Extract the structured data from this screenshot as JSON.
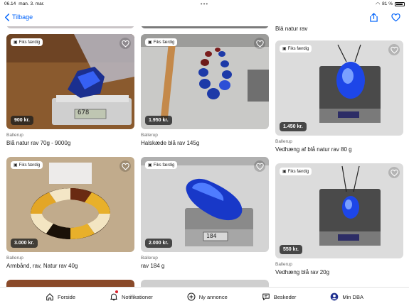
{
  "status_bar": {
    "time": "06.14",
    "date": "man. 3. mar.",
    "battery": "81 %"
  },
  "nav": {
    "back_label": "Tilbage"
  },
  "badge_label": "Fiks færdig",
  "partial_top_title": "Blå natur rav",
  "listings": [
    {
      "price": "900 kr.",
      "location": "Ballerup",
      "title": "Blå natur rav 70g - 9000g"
    },
    {
      "price": "1.950 kr.",
      "location": "Ballerup",
      "title": "Halskæde blå rav 145g"
    },
    {
      "price": "1.450 kr.",
      "location": "Ballerup",
      "title": "Vedhæng af blå natur rav 80 g"
    },
    {
      "price": "3.000 kr.",
      "location": "Ballerup",
      "title": "Armbånd, rav, Natur rav 40g"
    },
    {
      "price": "2.000 kr.",
      "location": "Ballerup",
      "title": "rav 184 g"
    },
    {
      "price": "550 kr.",
      "location": "Ballerup",
      "title": "Vedhæng blå rav 20g"
    }
  ],
  "scale_readouts": {
    "card1": "678",
    "card5": "184"
  },
  "tabs": [
    {
      "label": "Forside",
      "icon": "home-icon"
    },
    {
      "label": "Notifikationer",
      "icon": "bell-icon"
    },
    {
      "label": "Ny annonce",
      "icon": "plus-circle-icon"
    },
    {
      "label": "Beskeder",
      "icon": "chat-icon"
    },
    {
      "label": "Min DBA",
      "icon": "profile-icon"
    }
  ],
  "colors": {
    "accent": "#0063fb",
    "notification": "#d91f2a",
    "amber_blue": "#1f5bff"
  }
}
